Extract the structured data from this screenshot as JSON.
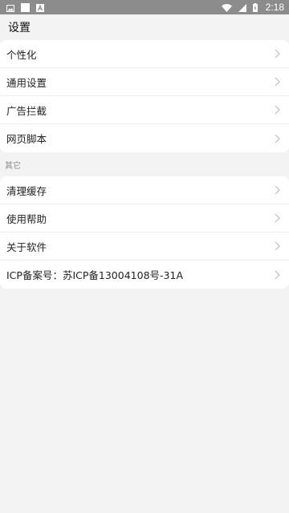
{
  "status_bar": {
    "time": "2:18",
    "icons": [
      "image-icon",
      "square-icon",
      "app-a-icon",
      "wifi-icon",
      "signal-icon",
      "battery-charging-icon"
    ],
    "background": "#8c8c8c"
  },
  "header": {
    "title": "设置"
  },
  "settings_group_1": {
    "items": [
      {
        "label": "个性化"
      },
      {
        "label": "通用设置"
      },
      {
        "label": "广告拦截"
      },
      {
        "label": "网页脚本"
      }
    ]
  },
  "others_section": {
    "title": "其它"
  },
  "settings_group_2": {
    "items": [
      {
        "label": "清理缓存"
      },
      {
        "label": "使用帮助"
      },
      {
        "label": "关于软件"
      },
      {
        "label": "ICP备案号：苏ICP备13004108号-31A"
      }
    ]
  },
  "colors": {
    "page_background": "#f3f3f3",
    "card_background": "#ffffff",
    "chevron": "#bdbdbd"
  }
}
